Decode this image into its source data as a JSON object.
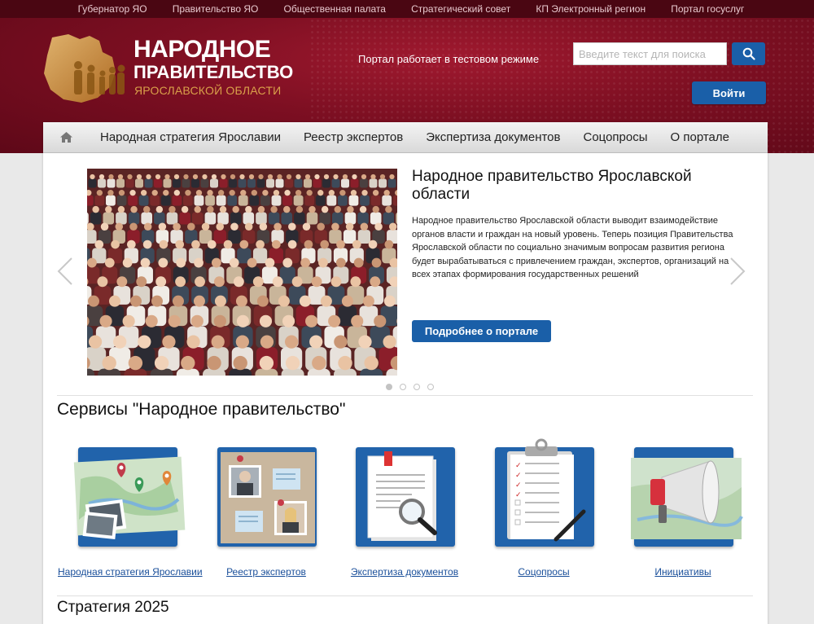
{
  "topbar": {
    "links": [
      "Губернатор ЯО",
      "Правительство ЯО",
      "Общественная палата",
      "Стратегический совет",
      "КП Электронный регион",
      "Портал госуслуг"
    ]
  },
  "header": {
    "logo_line1": "НАРОДНОЕ",
    "logo_line2": "ПРАВИТЕЛЬСТВО",
    "logo_line3": "ЯРОСЛАВСКОЙ ОБЛАСТИ",
    "test_mode": "Портал работает в тестовом режиме",
    "search_placeholder": "Введите текст для поиска",
    "login_label": "Войти"
  },
  "nav": {
    "items": [
      "Народная стратегия Ярославии",
      "Реестр экспертов",
      "Экспертиза документов",
      "Соцопросы",
      "О портале"
    ]
  },
  "slider": {
    "title": "Народное правительство Ярославской области",
    "text": "Народное правительство Ярославской области выводит взаимодействие органов власти и граждан на новый уровень. Теперь позиция Правительства Ярославской области по социально значимым вопросам развития региона будет вырабатываться с привлечением граждан, экспертов, организаций на всех этапах формирования государственных решений",
    "button": "Подробнее о портале",
    "dots_count": 4,
    "active_dot": 0
  },
  "services": {
    "title": "Сервисы \"Народное правительство\"",
    "items": [
      {
        "label": "Народная стратегия Ярославии",
        "icon": "map-pins-icon"
      },
      {
        "label": "Реестр экспертов",
        "icon": "corkboard-icon"
      },
      {
        "label": "Экспертиза документов",
        "icon": "document-magnifier-icon"
      },
      {
        "label": "Соцопросы",
        "icon": "clipboard-checklist-icon"
      },
      {
        "label": "Инициативы",
        "icon": "megaphone-icon"
      }
    ]
  },
  "strategy": {
    "title": "Стратегия 2025"
  },
  "colors": {
    "header_red": "#7d0f22",
    "topbar": "#4a0612",
    "accent_blue": "#1a5fa8",
    "logo_gold": "#d9a04a"
  }
}
